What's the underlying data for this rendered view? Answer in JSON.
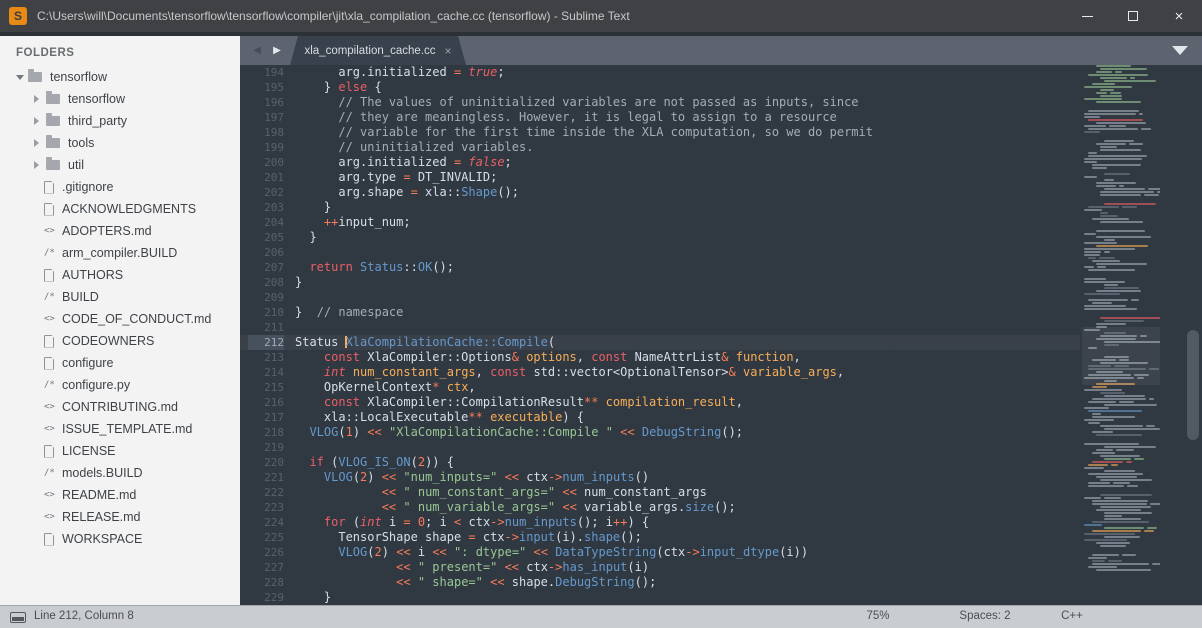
{
  "window": {
    "title": "C:\\Users\\will\\Documents\\tensorflow\\tensorflow\\compiler\\jit\\xla_compilation_cache.cc (tensorflow) - Sublime Text",
    "logo_letter": "S"
  },
  "icons": {
    "close": "×",
    "back": "◀",
    "fwd": "▶",
    "tab_close": "×"
  },
  "sidebar": {
    "header": "FOLDERS",
    "items": [
      {
        "kind": "folder",
        "label": "tensorflow",
        "level": 0,
        "expanded": true
      },
      {
        "kind": "folder",
        "label": "tensorflow",
        "level": 1,
        "expanded": false
      },
      {
        "kind": "folder",
        "label": "third_party",
        "level": 1,
        "expanded": false
      },
      {
        "kind": "folder",
        "label": "tools",
        "level": 1,
        "expanded": false
      },
      {
        "kind": "folder",
        "label": "util",
        "level": 1,
        "expanded": false
      },
      {
        "kind": "file",
        "icon": "doc",
        "label": ".gitignore"
      },
      {
        "kind": "file",
        "icon": "doc",
        "label": "ACKNOWLEDGMENTS"
      },
      {
        "kind": "file",
        "icon": "code",
        "label": "ADOPTERS.md"
      },
      {
        "kind": "file",
        "icon": "src",
        "label": "arm_compiler.BUILD"
      },
      {
        "kind": "file",
        "icon": "doc",
        "label": "AUTHORS"
      },
      {
        "kind": "file",
        "icon": "src",
        "label": "BUILD"
      },
      {
        "kind": "file",
        "icon": "code",
        "label": "CODE_OF_CONDUCT.md"
      },
      {
        "kind": "file",
        "icon": "doc",
        "label": "CODEOWNERS"
      },
      {
        "kind": "file",
        "icon": "doc",
        "label": "configure"
      },
      {
        "kind": "file",
        "icon": "src",
        "label": "configure.py"
      },
      {
        "kind": "file",
        "icon": "code",
        "label": "CONTRIBUTING.md"
      },
      {
        "kind": "file",
        "icon": "code",
        "label": "ISSUE_TEMPLATE.md"
      },
      {
        "kind": "file",
        "icon": "doc",
        "label": "LICENSE"
      },
      {
        "kind": "file",
        "icon": "src",
        "label": "models.BUILD"
      },
      {
        "kind": "file",
        "icon": "code",
        "label": "README.md"
      },
      {
        "kind": "file",
        "icon": "code",
        "label": "RELEASE.md"
      },
      {
        "kind": "file",
        "icon": "doc",
        "label": "WORKSPACE"
      }
    ]
  },
  "tab": {
    "label": "xla_compilation_cache.cc"
  },
  "editor": {
    "cursor_line": 212,
    "lines": [
      {
        "num": 194,
        "t": [
          [
            "t",
            "      arg.initialized "
          ],
          [
            "o",
            "="
          ],
          [
            "t",
            " "
          ],
          [
            "l",
            "true"
          ],
          [
            "t",
            ";"
          ]
        ]
      },
      {
        "num": 195,
        "t": [
          [
            "t",
            "    } "
          ],
          [
            "k",
            "else"
          ],
          [
            "t",
            " {"
          ]
        ]
      },
      {
        "num": 196,
        "t": [
          [
            "c",
            "      // The values of uninitialized variables are not passed as inputs, since"
          ]
        ]
      },
      {
        "num": 197,
        "t": [
          [
            "c",
            "      // they are meaningless. However, it is legal to assign to a resource"
          ]
        ]
      },
      {
        "num": 198,
        "t": [
          [
            "c",
            "      // variable for the first time inside the XLA computation, so we do permit"
          ]
        ]
      },
      {
        "num": 199,
        "t": [
          [
            "c",
            "      // uninitialized variables."
          ]
        ]
      },
      {
        "num": 200,
        "t": [
          [
            "t",
            "      arg.initialized "
          ],
          [
            "o",
            "="
          ],
          [
            "t",
            " "
          ],
          [
            "l",
            "false"
          ],
          [
            "t",
            ";"
          ]
        ]
      },
      {
        "num": 201,
        "t": [
          [
            "t",
            "      arg.type "
          ],
          [
            "o",
            "="
          ],
          [
            "t",
            " DT_INVALID;"
          ]
        ]
      },
      {
        "num": 202,
        "t": [
          [
            "t",
            "      arg.shape "
          ],
          [
            "o",
            "="
          ],
          [
            "t",
            " xla::"
          ],
          [
            "f",
            "Shape"
          ],
          [
            "t",
            "();"
          ]
        ]
      },
      {
        "num": 203,
        "t": [
          [
            "t",
            "    }"
          ]
        ]
      },
      {
        "num": 204,
        "t": [
          [
            "t",
            "    "
          ],
          [
            "o",
            "++"
          ],
          [
            "t",
            "input_num;"
          ]
        ]
      },
      {
        "num": 205,
        "t": [
          [
            "t",
            "  }"
          ]
        ]
      },
      {
        "num": 206,
        "t": [
          [
            "t",
            ""
          ]
        ]
      },
      {
        "num": 207,
        "t": [
          [
            "t",
            "  "
          ],
          [
            "k",
            "return"
          ],
          [
            "t",
            " "
          ],
          [
            "f",
            "Status"
          ],
          [
            "t",
            "::"
          ],
          [
            "f",
            "OK"
          ],
          [
            "t",
            "();"
          ]
        ]
      },
      {
        "num": 208,
        "t": [
          [
            "t",
            "}"
          ]
        ]
      },
      {
        "num": 209,
        "t": [
          [
            "t",
            ""
          ]
        ]
      },
      {
        "num": 210,
        "t": [
          [
            "t",
            "}  "
          ],
          [
            "c",
            "// namespace"
          ]
        ]
      },
      {
        "num": 211,
        "t": [
          [
            "t",
            ""
          ]
        ]
      },
      {
        "num": 212,
        "t": [
          [
            "t",
            "Status "
          ],
          [
            "cur",
            ""
          ],
          [
            "f",
            "XlaCompilationCache::Compile"
          ],
          [
            "t",
            "("
          ]
        ]
      },
      {
        "num": 213,
        "t": [
          [
            "t",
            "    "
          ],
          [
            "k",
            "const"
          ],
          [
            "t",
            " XlaCompiler::Options"
          ],
          [
            "o",
            "&"
          ],
          [
            "p",
            " options"
          ],
          [
            "t",
            ", "
          ],
          [
            "k",
            "const"
          ],
          [
            "t",
            " NameAttrList"
          ],
          [
            "o",
            "&"
          ],
          [
            "p",
            " function"
          ],
          [
            "t",
            ","
          ]
        ]
      },
      {
        "num": 214,
        "t": [
          [
            "t",
            "    "
          ],
          [
            "ki",
            "int"
          ],
          [
            "p",
            " num_constant_args"
          ],
          [
            "t",
            ", "
          ],
          [
            "k",
            "const"
          ],
          [
            "t",
            " std::vector<OptionalTensor>"
          ],
          [
            "o",
            "&"
          ],
          [
            "p",
            " variable_args"
          ],
          [
            "t",
            ","
          ]
        ]
      },
      {
        "num": 215,
        "t": [
          [
            "t",
            "    OpKernelContext"
          ],
          [
            "o",
            "*"
          ],
          [
            "p",
            " ctx"
          ],
          [
            "t",
            ","
          ]
        ]
      },
      {
        "num": 216,
        "t": [
          [
            "t",
            "    "
          ],
          [
            "k",
            "const"
          ],
          [
            "t",
            " XlaCompiler::CompilationResult"
          ],
          [
            "o",
            "**"
          ],
          [
            "p",
            " compilation_result"
          ],
          [
            "t",
            ","
          ]
        ]
      },
      {
        "num": 217,
        "t": [
          [
            "t",
            "    xla::LocalExecutable"
          ],
          [
            "o",
            "**"
          ],
          [
            "p",
            " executable"
          ],
          [
            "t",
            ") {"
          ]
        ]
      },
      {
        "num": 218,
        "t": [
          [
            "t",
            "  "
          ],
          [
            "f",
            "VLOG"
          ],
          [
            "t",
            "("
          ],
          [
            "n",
            "1"
          ],
          [
            "t",
            ") "
          ],
          [
            "o",
            "<<"
          ],
          [
            "t",
            " "
          ],
          [
            "s",
            "\"XlaCompilationCache::Compile \""
          ],
          [
            "t",
            " "
          ],
          [
            "o",
            "<<"
          ],
          [
            "t",
            " "
          ],
          [
            "f",
            "DebugString"
          ],
          [
            "t",
            "();"
          ]
        ]
      },
      {
        "num": 219,
        "t": [
          [
            "t",
            ""
          ]
        ]
      },
      {
        "num": 220,
        "t": [
          [
            "t",
            "  "
          ],
          [
            "k",
            "if"
          ],
          [
            "t",
            " ("
          ],
          [
            "f",
            "VLOG_IS_ON"
          ],
          [
            "t",
            "("
          ],
          [
            "n",
            "2"
          ],
          [
            "t",
            ")) {"
          ]
        ]
      },
      {
        "num": 221,
        "t": [
          [
            "t",
            "    "
          ],
          [
            "f",
            "VLOG"
          ],
          [
            "t",
            "("
          ],
          [
            "n",
            "2"
          ],
          [
            "t",
            ") "
          ],
          [
            "o",
            "<<"
          ],
          [
            "t",
            " "
          ],
          [
            "s",
            "\"num_inputs=\""
          ],
          [
            "t",
            " "
          ],
          [
            "o",
            "<<"
          ],
          [
            "t",
            " ctx"
          ],
          [
            "o",
            "->"
          ],
          [
            "f",
            "num_inputs"
          ],
          [
            "t",
            "()"
          ]
        ]
      },
      {
        "num": 222,
        "t": [
          [
            "t",
            "            "
          ],
          [
            "o",
            "<<"
          ],
          [
            "t",
            " "
          ],
          [
            "s",
            "\" num_constant_args=\""
          ],
          [
            "t",
            " "
          ],
          [
            "o",
            "<<"
          ],
          [
            "t",
            " num_constant_args"
          ]
        ]
      },
      {
        "num": 223,
        "t": [
          [
            "t",
            "            "
          ],
          [
            "o",
            "<<"
          ],
          [
            "t",
            " "
          ],
          [
            "s",
            "\" num_variable_args=\""
          ],
          [
            "t",
            " "
          ],
          [
            "o",
            "<<"
          ],
          [
            "t",
            " variable_args."
          ],
          [
            "f",
            "size"
          ],
          [
            "t",
            "();"
          ]
        ]
      },
      {
        "num": 224,
        "t": [
          [
            "t",
            "    "
          ],
          [
            "k",
            "for"
          ],
          [
            "t",
            " ("
          ],
          [
            "ki",
            "int"
          ],
          [
            "t",
            " i "
          ],
          [
            "o",
            "="
          ],
          [
            "t",
            " "
          ],
          [
            "n",
            "0"
          ],
          [
            "t",
            "; i "
          ],
          [
            "o",
            "<"
          ],
          [
            "t",
            " ctx"
          ],
          [
            "o",
            "->"
          ],
          [
            "f",
            "num_inputs"
          ],
          [
            "t",
            "(); i"
          ],
          [
            "o",
            "++"
          ],
          [
            "t",
            ") {"
          ]
        ]
      },
      {
        "num": 225,
        "t": [
          [
            "t",
            "      TensorShape shape "
          ],
          [
            "o",
            "="
          ],
          [
            "t",
            " ctx"
          ],
          [
            "o",
            "->"
          ],
          [
            "f",
            "input"
          ],
          [
            "t",
            "(i)."
          ],
          [
            "f",
            "shape"
          ],
          [
            "t",
            "();"
          ]
        ]
      },
      {
        "num": 226,
        "t": [
          [
            "t",
            "      "
          ],
          [
            "f",
            "VLOG"
          ],
          [
            "t",
            "("
          ],
          [
            "n",
            "2"
          ],
          [
            "t",
            ") "
          ],
          [
            "o",
            "<<"
          ],
          [
            "t",
            " i "
          ],
          [
            "o",
            "<<"
          ],
          [
            "t",
            " "
          ],
          [
            "s",
            "\": dtype=\""
          ],
          [
            "t",
            " "
          ],
          [
            "o",
            "<<"
          ],
          [
            "t",
            " "
          ],
          [
            "f",
            "DataTypeString"
          ],
          [
            "t",
            "(ctx"
          ],
          [
            "o",
            "->"
          ],
          [
            "f",
            "input_dtype"
          ],
          [
            "t",
            "(i))"
          ]
        ]
      },
      {
        "num": 227,
        "t": [
          [
            "t",
            "              "
          ],
          [
            "o",
            "<<"
          ],
          [
            "t",
            " "
          ],
          [
            "s",
            "\" present=\""
          ],
          [
            "t",
            " "
          ],
          [
            "o",
            "<<"
          ],
          [
            "t",
            " ctx"
          ],
          [
            "o",
            "->"
          ],
          [
            "f",
            "has_input"
          ],
          [
            "t",
            "(i)"
          ]
        ]
      },
      {
        "num": 228,
        "t": [
          [
            "t",
            "              "
          ],
          [
            "o",
            "<<"
          ],
          [
            "t",
            " "
          ],
          [
            "s",
            "\" shape=\""
          ],
          [
            "t",
            " "
          ],
          [
            "o",
            "<<"
          ],
          [
            "t",
            " shape."
          ],
          [
            "f",
            "DebugString"
          ],
          [
            "t",
            "();"
          ]
        ]
      },
      {
        "num": 229,
        "t": [
          [
            "t",
            "    }"
          ]
        ]
      }
    ],
    "minimap_blocks": [
      {
        "n": 13,
        "c": "g"
      },
      {
        "n": 2,
        "c": "e"
      },
      {
        "n": 3,
        "c": "w"
      },
      {
        "n": 1,
        "c": "r"
      },
      {
        "n": 4,
        "c": "w"
      },
      {
        "n": 2,
        "c": "e"
      },
      {
        "n": 10,
        "c": "w"
      },
      {
        "n": 1,
        "c": "e"
      },
      {
        "n": 8,
        "c": "w"
      },
      {
        "n": 2,
        "c": "e"
      },
      {
        "n": 1,
        "c": "r"
      },
      {
        "n": 6,
        "c": "w"
      },
      {
        "n": 2,
        "c": "e"
      },
      {
        "n": 5,
        "c": "w"
      },
      {
        "n": 1,
        "c": "o"
      },
      {
        "n": 8,
        "c": "w"
      },
      {
        "n": 2,
        "c": "e"
      },
      {
        "n": 6,
        "c": "w"
      },
      {
        "n": 1,
        "c": "e"
      },
      {
        "n": 4,
        "c": "w"
      },
      {
        "n": 2,
        "c": "e"
      },
      {
        "n": 1,
        "c": "r"
      },
      {
        "n": 10,
        "c": "w"
      },
      {
        "n": 2,
        "c": "e"
      },
      {
        "n": 8,
        "c": "w"
      },
      {
        "n": 3,
        "c": "m"
      },
      {
        "n": 6,
        "c": "w"
      },
      {
        "n": 2,
        "c": "m"
      },
      {
        "n": 8,
        "c": "w"
      },
      {
        "n": 2,
        "c": "e"
      },
      {
        "n": 5,
        "c": "w"
      },
      {
        "n": 3,
        "c": "m"
      },
      {
        "n": 7,
        "c": "w"
      },
      {
        "n": 2,
        "c": "e"
      },
      {
        "n": 10,
        "c": "w"
      },
      {
        "n": 3,
        "c": "m"
      },
      {
        "n": 5,
        "c": "w"
      },
      {
        "n": 2,
        "c": "e"
      },
      {
        "n": 6,
        "c": "w"
      }
    ]
  },
  "status": {
    "position": "Line 212, Column 8",
    "zoom": "75%",
    "spaces": "Spaces: 2",
    "syntax": "C++"
  },
  "colors": {
    "editor_bg": "#303841",
    "accent_orange": "#f9ae58",
    "keyword_red": "#ec5f66",
    "string_green": "#99c794",
    "function_blue": "#6699cc",
    "logo_orange": "#e98a17"
  }
}
